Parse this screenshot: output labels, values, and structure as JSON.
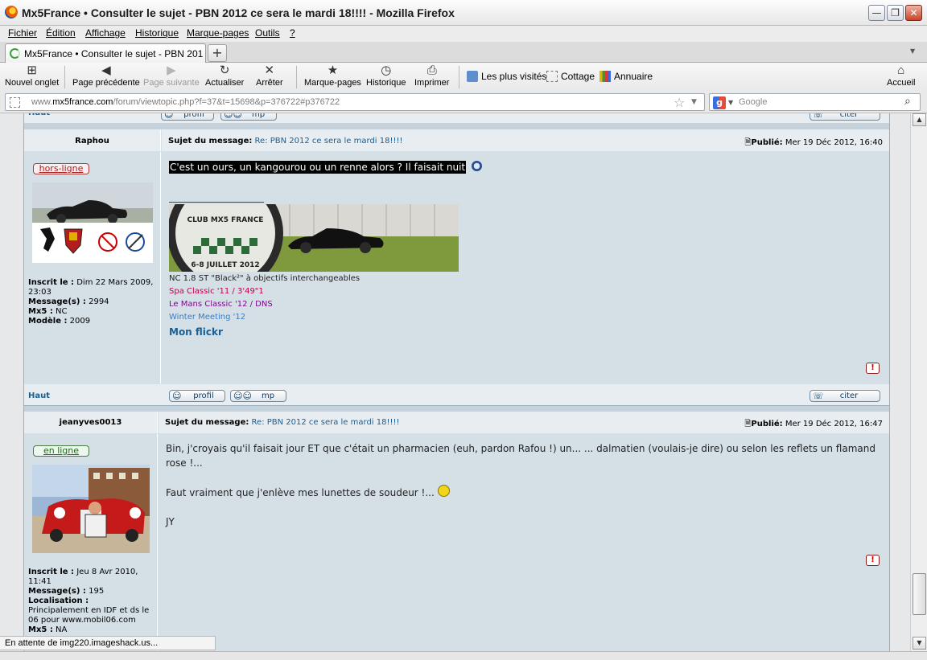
{
  "window": {
    "title": "Mx5France • Consulter le sujet - PBN 2012 ce sera le mardi 18!!!! - Mozilla Firefox",
    "min": "—",
    "max": "❐",
    "close": "✕"
  },
  "menu": [
    "Fichier",
    "Édition",
    "Affichage",
    "Historique",
    "Marque-pages",
    "Outils",
    "?"
  ],
  "tab": {
    "label": "Mx5France • Consulter le sujet - PBN 2012 c...",
    "new": "+"
  },
  "toolbar": {
    "new_tab": "Nouvel onglet",
    "back": "Page précédente",
    "forward": "Page suivante",
    "reload": "Actualiser",
    "stop": "Arrêter",
    "bookmarks": "Marque-pages",
    "history": "Historique",
    "print": "Imprimer",
    "most_visited": "Les plus visités",
    "cottage": "Cottage",
    "annuaire": "Annuaire",
    "home": "Accueil"
  },
  "address": {
    "prefix": "www.",
    "domain": "mx5france.com",
    "path": "/forum/viewtopic.php?f=37&t=15698&p=376722#p376722",
    "search_placeholder": "Google"
  },
  "forum": {
    "top_link": "Haut",
    "profile_btn": "profil",
    "mp_btn": "mp",
    "quote_btn": "citer",
    "subject_label": "Sujet du message:",
    "published_label": "Publié:",
    "report": "!"
  },
  "posts": [
    {
      "author": "Raphou",
      "status": "hors-ligne",
      "subject": "Re: PBN 2012 ce sera le mardi 18!!!!",
      "date": "Mer 19 Déc 2012, 16:40",
      "body": "C'est un ours, un kangourou ou un renne alors ? Il faisait nuit",
      "profile": {
        "registered_label": "Inscrit le :",
        "registered": "Dim 22 Mars 2009, 23:03",
        "messages_label": "Message(s) :",
        "messages": "2994",
        "mx5_label": "Mx5 :",
        "mx5": "NC",
        "model_label": "Modèle :",
        "model": "2009"
      },
      "signature": {
        "banner_text": "CLUB MX5 FRANCE",
        "banner_date": "6-8 JUILLET 2012",
        "line1": "NC 1.8 ST \"Black²\" à objectifs interchangeables",
        "line2": "Spa Classic '11 / 3'49\"1",
        "line3": "Le Mans Classic '12 / DNS",
        "line4": "Winter Meeting '12",
        "flickr": "Mon flickr"
      }
    },
    {
      "author": "jeanyves0013",
      "status": "en ligne",
      "subject": "Re: PBN 2012 ce sera le mardi 18!!!!",
      "date": "Mer 19 Déc 2012, 16:47",
      "body_p1": "Bin, j'croyais qu'il faisait jour ET que c'était un pharmacien (euh, pardon Rafou !) un... ... dalmatien (voulais-je dire) ou selon les reflets un flamand rose !...",
      "body_p2": "Faut vraiment que j'enlève mes lunettes de soudeur !...",
      "body_p3": "JY",
      "profile": {
        "registered_label": "Inscrit le :",
        "registered": "Jeu 8 Avr 2010, 11:41",
        "messages_label": "Message(s) :",
        "messages": "195",
        "location_label": "Localisation :",
        "location": "Principalement en IDF et ds le 06 pour www.mobil06.com",
        "mx5_label": "Mx5 :",
        "mx5": "NA"
      }
    }
  ],
  "status": "En attente de img220.imageshack.us...",
  "colors": {
    "link": "#1b5e8f",
    "spa": "#c0004a",
    "lemans": "#7a0a8a",
    "winter": "#3b7dc4",
    "flickr": "#1b5e8f"
  }
}
